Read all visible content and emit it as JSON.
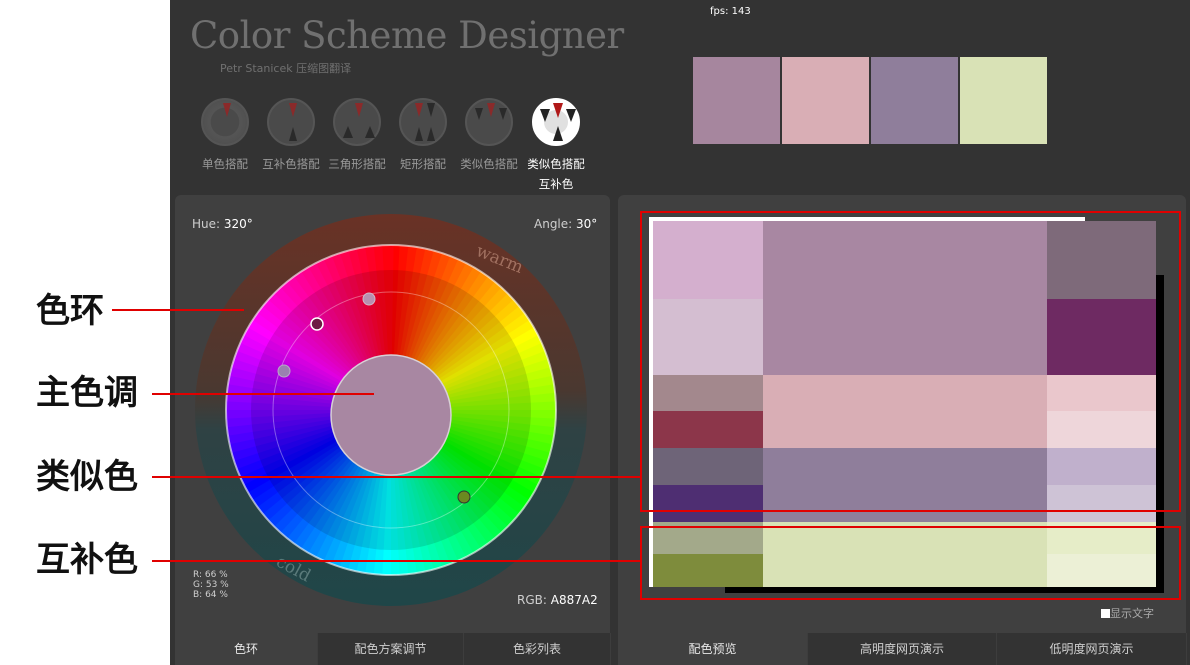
{
  "annotations": {
    "wheel": "色环",
    "main_hue": "主色调",
    "analogous": "类似色",
    "complement": "互补色"
  },
  "app": {
    "title": "Color Scheme Designer",
    "subtitle": "Petr Stanicek 压缩图翻译",
    "fps": "fps: 143"
  },
  "palette": [
    "#A6869E",
    "#D9AEB5",
    "#8F7E9B",
    "#D9E2B6"
  ],
  "schemes": [
    {
      "label": "单色搭配",
      "active": false
    },
    {
      "label": "互补色搭配",
      "active": false
    },
    {
      "label": "三角形搭配",
      "active": false
    },
    {
      "label": "矩形搭配",
      "active": false
    },
    {
      "label": "类似色搭配",
      "active": false
    },
    {
      "label": "类似色搭配互补色",
      "active": true
    }
  ],
  "wheel": {
    "hue_label": "Hue:",
    "hue_value": "320°",
    "angle_label": "Angle:",
    "angle_value": "30°",
    "warm": "warm",
    "cold": "cold",
    "center_color": "#A887A2",
    "r": "R: 66 %",
    "g": "G: 53 %",
    "b": "B: 64 %",
    "rgb_label": "RGB:",
    "rgb_value": "A887A2"
  },
  "left_tabs": [
    "色环",
    "配色方案调节",
    "色彩列表"
  ],
  "right_tabs": [
    "配色预览",
    "高明度网页演示",
    "低明度网页演示"
  ],
  "show_text_label": "显示文字",
  "preview_colors": {
    "main": "#A887A2",
    "main_light": "#D4AFCE",
    "main_pale": "#D4BED1",
    "main_dark": "#7E6A7A",
    "main_deep": "#6E2A62",
    "pink": "#D9AEB5",
    "pink_grey": "#A3888D",
    "pink_deep": "#8C364A",
    "pink_light": "#EAC7CC",
    "pink_pale": "#EED6DA",
    "violet": "#8F7E9B",
    "violet_grey": "#6E6478",
    "violet_deep": "#4E2E72",
    "violet_light": "#C0B0CC",
    "violet_pale": "#CEC3D6",
    "green": "#D9E2B6",
    "green_grey": "#A3A98A",
    "green_deep": "#7E8C3C",
    "green_light": "#E6EDC8",
    "green_pale": "#ECF0D6"
  }
}
